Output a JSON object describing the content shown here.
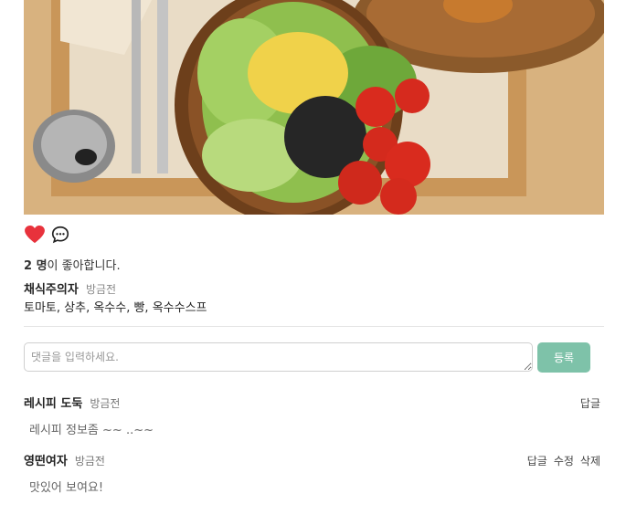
{
  "post": {
    "like_count": "2 명",
    "like_suffix": "이 좋아합니다.",
    "author": "채식주의자",
    "time": "방금전",
    "caption": "토마토, 상추, 옥수수, 빵, 옥수수스프"
  },
  "comment_form": {
    "placeholder": "댓글을 입력하세요.",
    "submit_label": "등록"
  },
  "comments": [
    {
      "author": "레시피 도둑",
      "time": "방금전",
      "body": "레시피 정보좀 ~~ ..~~",
      "reply": "답글"
    },
    {
      "author": "영떤여자",
      "time": "방금전",
      "body": "맛있어 보여요!",
      "reply": "답글",
      "edit": "수정",
      "delete": "삭제"
    }
  ],
  "colors": {
    "like": "#e8323c",
    "submit_bg": "#7ec2a9"
  },
  "icons": {
    "like": "heart-icon",
    "comment": "speech-bubble-icon"
  }
}
